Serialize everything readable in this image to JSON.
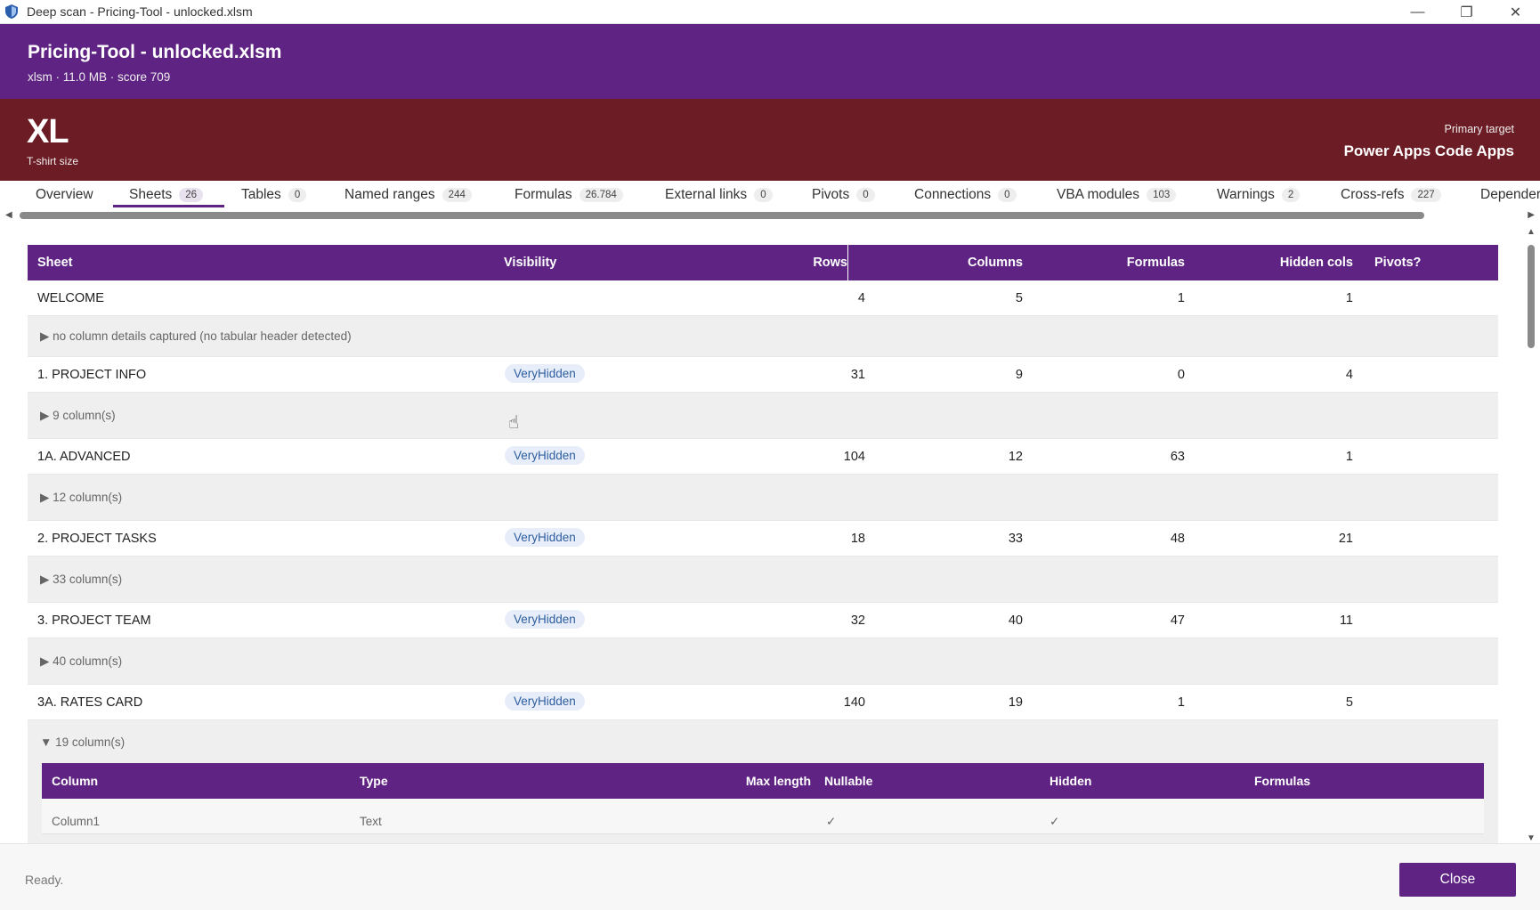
{
  "window": {
    "title": "Deep scan - Pricing-Tool - unlocked.xlsm",
    "controls": {
      "minimize": "—",
      "restore": "❐",
      "close": "✕"
    }
  },
  "header": {
    "title": "Pricing-Tool - unlocked.xlsm",
    "subtitle": "xlsm · 11.0 MB · score 709"
  },
  "size_band": {
    "size": "XL",
    "size_caption": "T-shirt size",
    "target_caption": "Primary target",
    "target_value": "Power Apps Code Apps"
  },
  "tabs": [
    {
      "label": "Overview",
      "badge": ""
    },
    {
      "label": "Sheets",
      "badge": "26"
    },
    {
      "label": "Tables",
      "badge": "0"
    },
    {
      "label": "Named ranges",
      "badge": "244"
    },
    {
      "label": "Formulas",
      "badge": "26.784"
    },
    {
      "label": "External links",
      "badge": "0"
    },
    {
      "label": "Pivots",
      "badge": "0"
    },
    {
      "label": "Connections",
      "badge": "0"
    },
    {
      "label": "VBA modules",
      "badge": "103"
    },
    {
      "label": "Warnings",
      "badge": "2"
    },
    {
      "label": "Cross-refs",
      "badge": "227"
    },
    {
      "label": "Depender",
      "badge": ""
    }
  ],
  "active_tab": "Sheets",
  "table": {
    "headers": [
      "Sheet",
      "Visibility",
      "Rows",
      "Columns",
      "Formulas",
      "Hidden cols",
      "Pivots?"
    ],
    "rows": [
      {
        "sheet": "WELCOME",
        "visibility": "",
        "rows": "4",
        "columns": "5",
        "formulas": "1",
        "hidden_cols": "1",
        "pivots": "",
        "detail": "▶ no column details captured (no tabular header detected)"
      },
      {
        "sheet": "1. PROJECT INFO",
        "visibility": "VeryHidden",
        "rows": "31",
        "columns": "9",
        "formulas": "0",
        "hidden_cols": "4",
        "pivots": "",
        "detail": "▶ 9 column(s)"
      },
      {
        "sheet": "1A. ADVANCED",
        "visibility": "VeryHidden",
        "rows": "104",
        "columns": "12",
        "formulas": "63",
        "hidden_cols": "1",
        "pivots": "",
        "detail": "▶ 12 column(s)"
      },
      {
        "sheet": "2. PROJECT TASKS",
        "visibility": "VeryHidden",
        "rows": "18",
        "columns": "33",
        "formulas": "48",
        "hidden_cols": "21",
        "pivots": "",
        "detail": "▶ 33 column(s)"
      },
      {
        "sheet": "3. PROJECT TEAM",
        "visibility": "VeryHidden",
        "rows": "32",
        "columns": "40",
        "formulas": "47",
        "hidden_cols": "11",
        "pivots": "",
        "detail": "▶ 40 column(s)"
      },
      {
        "sheet": "3A. RATES CARD",
        "visibility": "VeryHidden",
        "rows": "140",
        "columns": "19",
        "formulas": "1",
        "hidden_cols": "5",
        "pivots": "",
        "detail": "▼ 19 column(s)"
      }
    ]
  },
  "column_table": {
    "headers": [
      "Column",
      "Type",
      "Max length",
      "Nullable",
      "Hidden",
      "Formulas"
    ],
    "rows": [
      {
        "column": "Column1",
        "type": "Text",
        "max_length": "",
        "nullable": "✓",
        "hidden": "✓",
        "formulas": ""
      }
    ]
  },
  "footer": {
    "status": "Ready.",
    "close_label": "Close"
  },
  "colors": {
    "purple": "#5f2483",
    "maroon": "#6c1c24",
    "pill_bg": "#e7eef9",
    "pill_text": "#2e5d9f"
  }
}
